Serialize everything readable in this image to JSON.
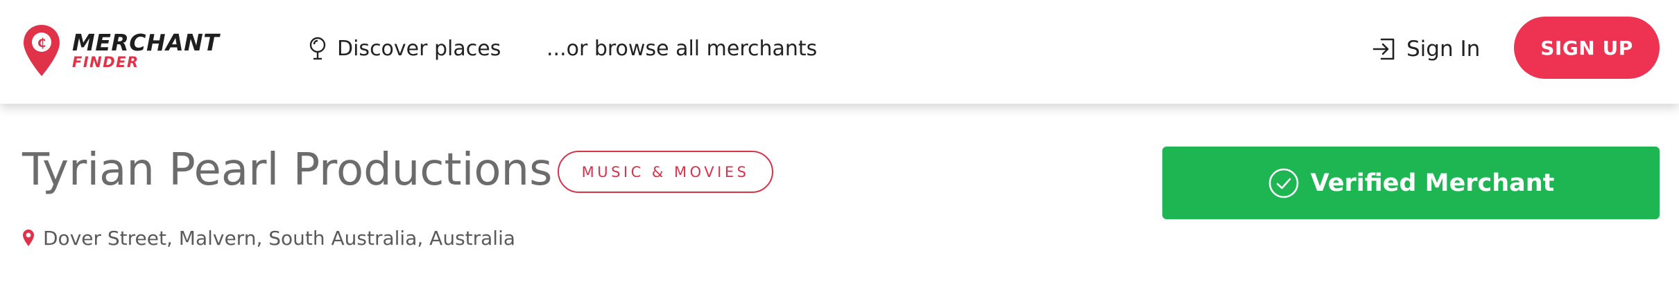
{
  "brand": {
    "line1": "MERCHANT",
    "line2": "FINDER",
    "primary_color": "#ee3251",
    "pin_color": "#e0334a"
  },
  "nav": {
    "discover_label": "Discover places",
    "discover_icon": "map-marker-outline-icon",
    "browse_label": "...or browse all merchants"
  },
  "auth": {
    "signin_label": "Sign In",
    "signin_icon": "login-icon",
    "signup_label": "SIGN UP"
  },
  "merchant": {
    "name": "Tyrian Pearl Productions",
    "category": "MUSIC & MOVIES",
    "location": "Dover Street, Malvern, South Australia, Australia",
    "location_icon": "location-pin-icon",
    "verified_label": "Verified Merchant",
    "verified_icon": "check-circle-icon",
    "verified_color": "#1db652"
  }
}
